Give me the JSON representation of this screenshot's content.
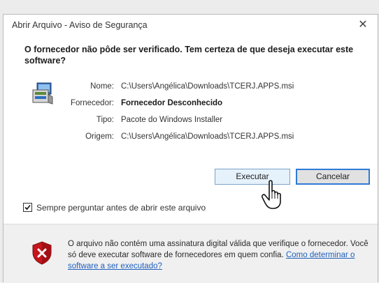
{
  "dialog": {
    "title": "Abrir Arquivo - Aviso de Segurança",
    "close_glyph": "✕"
  },
  "question": "O fornecedor não pôde ser verificado. Tem certeza de que deseja executar este software?",
  "details": {
    "name_label": "Nome:",
    "name_value": "C:\\Users\\Angélica\\Downloads\\TCERJ.APPS.msi",
    "publisher_label": "Fornecedor:",
    "publisher_value": "Fornecedor Desconhecido",
    "type_label": "Tipo:",
    "type_value": "Pacote do Windows Installer",
    "origin_label": "Origem:",
    "origin_value": "C:\\Users\\Angélica\\Downloads\\TCERJ.APPS.msi"
  },
  "buttons": {
    "run_label": "Executar",
    "cancel_label": "Cancelar"
  },
  "checkbox": {
    "label": "Sempre perguntar antes de abrir este arquivo",
    "checked": true
  },
  "warning": {
    "text": "O arquivo não contém uma assinatura digital válida que verifique o fornecedor. Você só deve executar software de fornecedores em quem confia.",
    "link_text": "Como determinar o software a ser executado?"
  },
  "icons": {
    "app": "installer-package-icon",
    "shield": "security-shield-icon",
    "cursor": "hand-pointer-icon",
    "check": "checkmark-icon"
  },
  "colors": {
    "link": "#1e5fbf",
    "focus_border": "#2f7ad6",
    "shield_red": "#c4161c"
  }
}
